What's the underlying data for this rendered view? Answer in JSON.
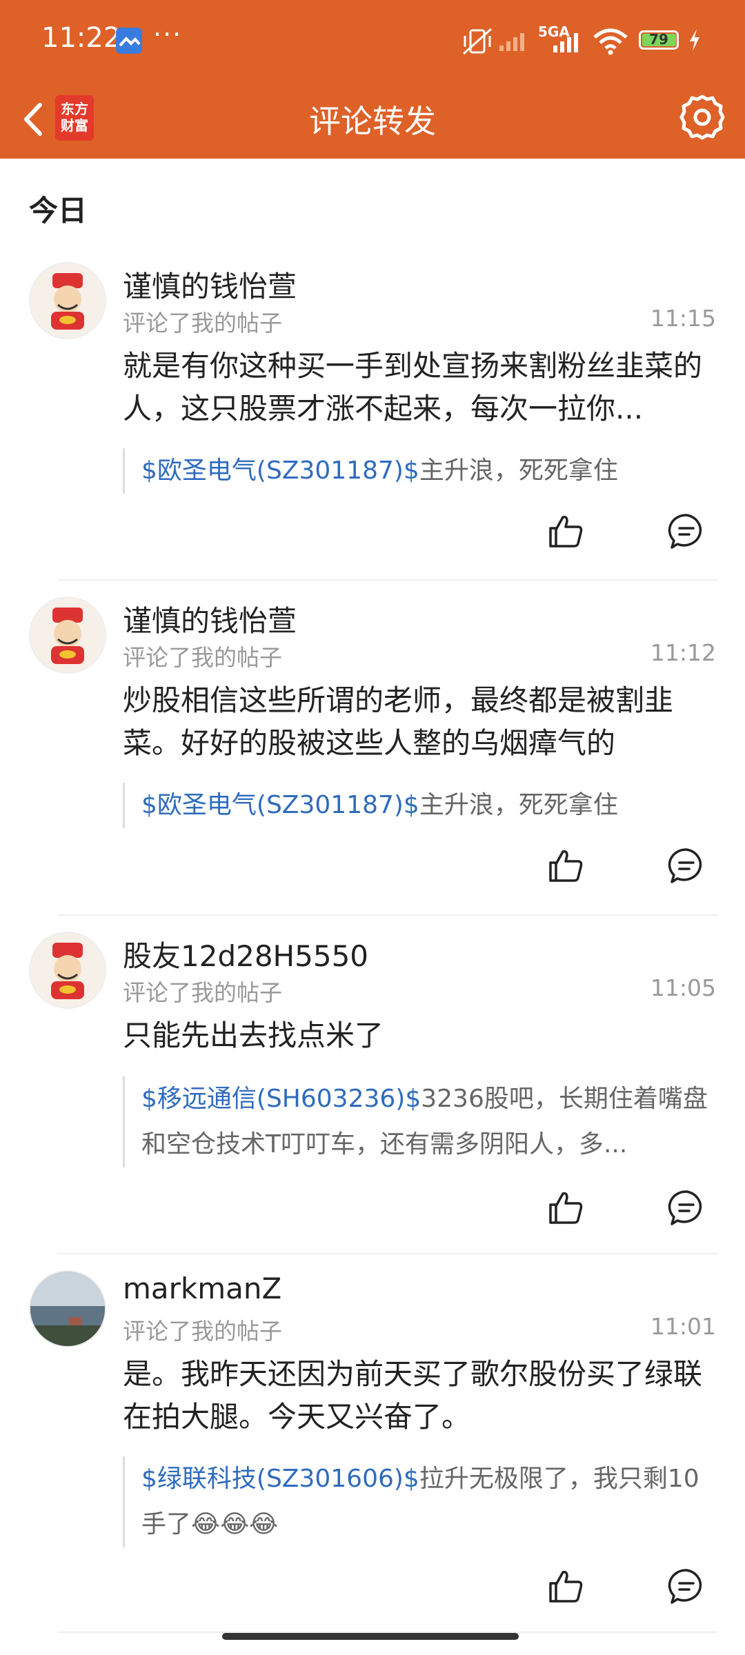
{
  "status_bar": {
    "time": "11:22",
    "dots": "···",
    "network": "5GA",
    "battery": "79"
  },
  "header": {
    "title": "评论转发",
    "logo_line1": "东方",
    "logo_line2": "财富"
  },
  "section": {
    "label": "今日"
  },
  "items": [
    {
      "name": "谨慎的钱怡萱",
      "action": "评论了我的帖子",
      "time": "11:15",
      "content": "就是有你这种买一手到处宣扬来割粉丝韭菜的人，这只股票才涨不起来，每次一拉你...",
      "stock": "$欧圣电气(SZ301187)$",
      "quote": "主升浪，死死拿住"
    },
    {
      "name": "谨慎的钱怡萱",
      "action": "评论了我的帖子",
      "time": "11:12",
      "content": "炒股相信这些所谓的老师，最终都是被割韭菜。好好的股被这些人整的乌烟瘴气的",
      "stock": "$欧圣电气(SZ301187)$",
      "quote": "主升浪，死死拿住"
    },
    {
      "name": "股友12d28H5550",
      "action": "评论了我的帖子",
      "time": "11:05",
      "content": "只能先出去找点米了",
      "stock": "$移远通信(SH603236)$",
      "quote": "3236股吧，长期住着嘴盘和空仓技术T叮叮车，还有需多阴阳人，多..."
    },
    {
      "name": "markmanZ",
      "action": "评论了我的帖子",
      "time": "11:01",
      "content": "是。我昨天还因为前天买了歌尔股份买了绿联在拍大腿。今天又兴奋了。",
      "stock": "$绿联科技(SZ301606)$",
      "quote": "拉升无极限了，我只剩10手了😂😂😂"
    }
  ]
}
